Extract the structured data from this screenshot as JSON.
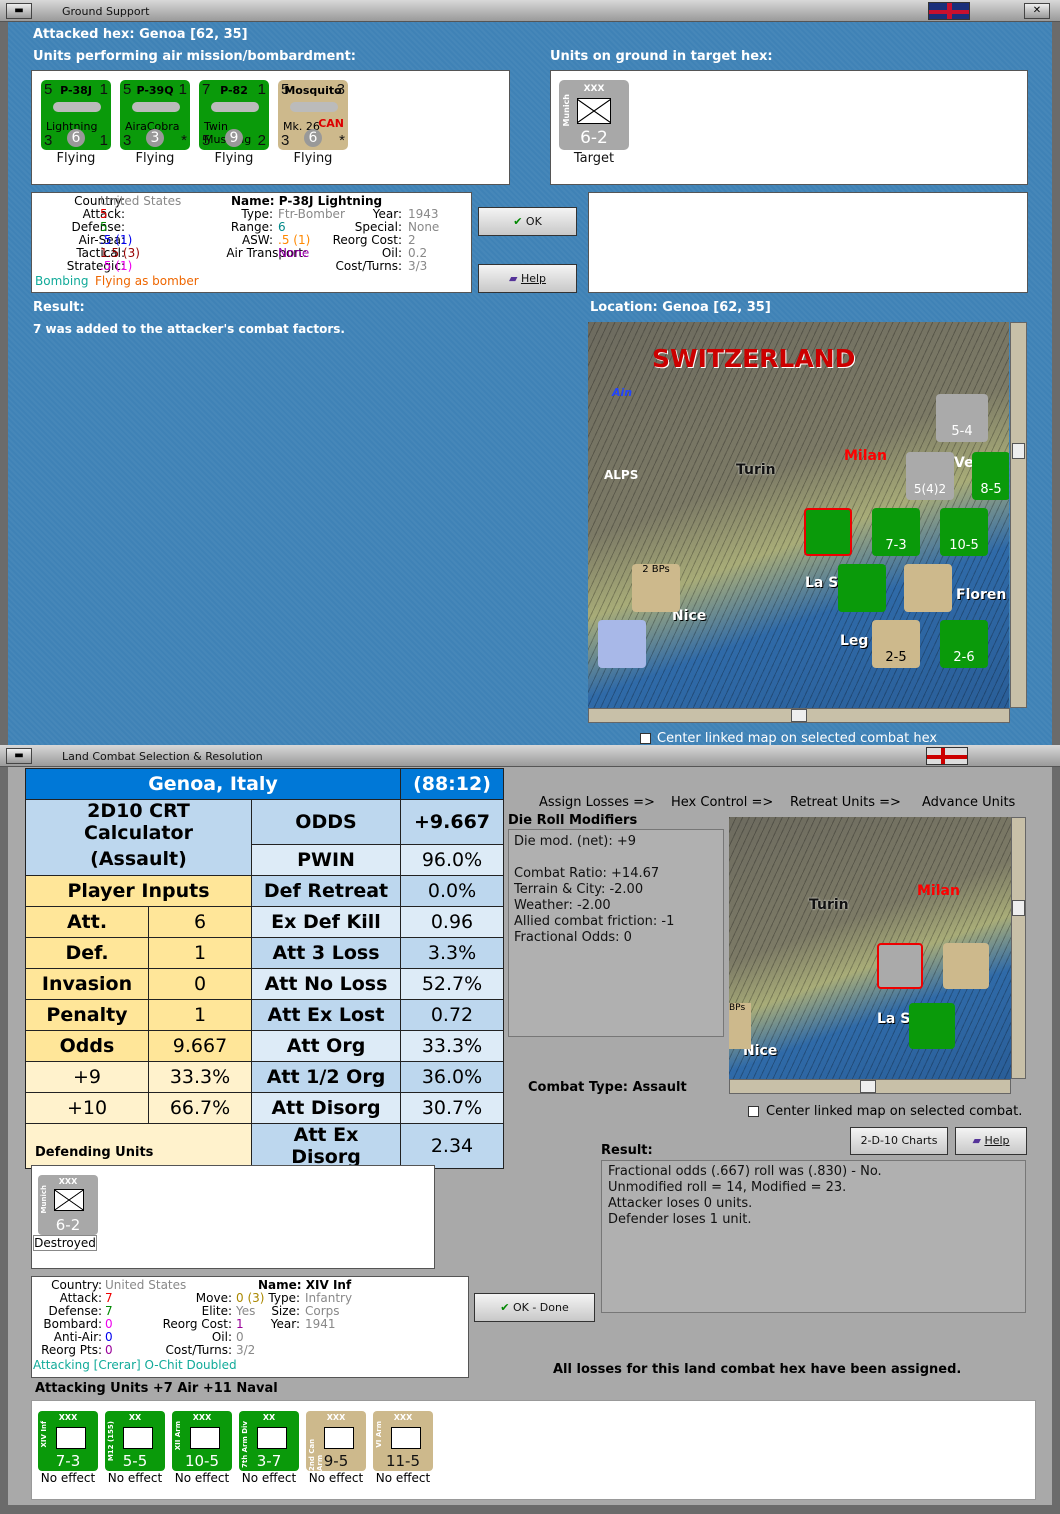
{
  "top_window": {
    "title": "Ground Support",
    "attacked_hex": "Attacked hex: Genoa  [62, 35]",
    "air_units_label": "Units performing air mission/bombardment:",
    "ground_units_label": "Units on ground in target hex:",
    "air_units": [
      {
        "name": "P-38J",
        "sub": "Lightning",
        "tl": "5",
        "tr": "1",
        "bl": "3",
        "bc": "6",
        "br": "1",
        "status": "Flying",
        "color": "green"
      },
      {
        "name": "P-39Q",
        "sub": "AiraCobra",
        "tl": "5",
        "tr": "1",
        "bl": "3",
        "bc": "3",
        "br": "*",
        "status": "Flying",
        "color": "green"
      },
      {
        "name": "P-82",
        "sub": "Twin Mustang",
        "tl": "7",
        "tr": "1",
        "bl": "5",
        "bc": "9",
        "br": "2",
        "status": "Flying",
        "color": "green"
      },
      {
        "name": "Mosquito",
        "sub": "Mk. 26",
        "extra": "CAN",
        "tl": "5",
        "tr": "3",
        "bl": "3",
        "bc": "6",
        "br": "*",
        "status": "Flying",
        "color": "tan"
      }
    ],
    "ground_units": [
      {
        "name": "Munich",
        "size": "XXX",
        "value": "6-2",
        "status": "Target"
      }
    ],
    "unit_info": {
      "country_l": "Country:",
      "country": "United States",
      "attack_l": "Attack:",
      "attack": "5",
      "defense_l": "Defense:",
      "defense": "5",
      "airsea_l": "Air-Sea:",
      "airsea": ".5 (1)",
      "tactical_l": "Tactical:",
      "tactical": "1.5 (3)",
      "strategic_l": "Strategic:",
      "strategic": ".5 (1)",
      "mission_a": "Bombing",
      "mission_b": "Flying as bomber",
      "name": "Name: P-38J Lightning",
      "type_l": "Type:",
      "type": "Ftr-Bomber",
      "range_l": "Range:",
      "range": "6",
      "asw_l": "ASW:",
      "asw": ".5 (1)",
      "airtrans_l": "Air Transport:",
      "airtrans": "None",
      "year_l": "Year:",
      "year": "1943",
      "special_l": "Special:",
      "special": "None",
      "reorg_l": "Reorg Cost:",
      "reorg": "2",
      "oil_l": "Oil:",
      "oil": "0.2",
      "cost_l": "Cost/Turns:",
      "cost": "3/3"
    },
    "ok_label": "OK",
    "help_label": "Help",
    "result_label": "Result:",
    "result_text": "7 was added to the attacker's combat factors.",
    "location": "Location:  Genoa  [62, 35]",
    "map_labels": {
      "switzerland": "SWITZERLAND",
      "alps": "ALPS",
      "turin": "Turin",
      "milan": "Milan",
      "nice": "Nice",
      "la_s": "La S",
      "leg": "Leg",
      "floren": "Floren",
      "ain": "Ain",
      "bps": "2 BPs",
      "ve": "Ve",
      "c54": "5-4",
      "c85": "8-5",
      "c73": "7-3",
      "c105": "10-5",
      "c25": "2-5",
      "c26": "2-6",
      "c542": "5(4)2"
    },
    "center_checkbox": "Center linked map on selected combat hex"
  },
  "bottom_window": {
    "title": "Land Combat Selection & Resolution",
    "crt": {
      "location": "Genoa, Italy",
      "ratio": "(88:12)",
      "calc_title": "2D10 CRT Calculator",
      "calc_mode": "(Assault)",
      "player_inputs": "Player Inputs",
      "inputs": [
        {
          "label": "Att.",
          "value": "6"
        },
        {
          "label": "Def.",
          "value": "1"
        },
        {
          "label": "Invasion",
          "value": "0"
        },
        {
          "label": "Penalty",
          "value": "1"
        },
        {
          "label": "Odds",
          "value": "9.667"
        }
      ],
      "odds_rows": [
        {
          "label": "+9",
          "value": "33.3%"
        },
        {
          "label": "+10",
          "value": "66.7%"
        }
      ],
      "results": [
        {
          "label": "ODDS",
          "value": "+9.667"
        },
        {
          "label": "PWIN",
          "value": "96.0%"
        },
        {
          "label": "Def Retreat",
          "value": "0.0%"
        },
        {
          "label": "Ex Def Kill",
          "value": "0.96"
        },
        {
          "label": "Att 3 Loss",
          "value": "3.3%"
        },
        {
          "label": "Att No Loss",
          "value": "52.7%"
        },
        {
          "label": "Att Ex Lost",
          "value": "0.72"
        },
        {
          "label": "Att Org",
          "value": "33.3%"
        },
        {
          "label": "Att 1/2 Org",
          "value": "36.0%"
        },
        {
          "label": "Att Disorg",
          "value": "30.7%"
        },
        {
          "label": "Att Ex Disorg",
          "value": "2.34"
        }
      ]
    },
    "steps": [
      "Assign Losses =>",
      "Hex Control =>",
      "Retreat Units =>",
      "Advance Units"
    ],
    "modifiers_label": "Die Roll Modifiers",
    "modifiers": [
      "Die mod. (net): +9",
      "",
      "Combat Ratio: +14.67",
      "Terrain & City: -2.00",
      "Weather: -2.00",
      "Allied combat friction: -1",
      "Fractional Odds: 0"
    ],
    "combat_type": "Combat Type:  Assault",
    "center_checkbox": "Center linked map on selected combat.",
    "charts_label": "2-D-10 Charts",
    "help_label": "Help",
    "result_label": "Result:",
    "result_lines": [
      "Fractional odds (.667) roll was (.830)  - No.",
      "Unmodified roll = 14, Modified = 23.",
      "Attacker loses 0 units.",
      "Defender loses 1 unit."
    ],
    "defending_label": "Defending Units",
    "defenders": [
      {
        "name": "Munich",
        "size": "XXX",
        "value": "6-2",
        "status": "Destroyed"
      }
    ],
    "unit_info": {
      "country_l": "Country:",
      "country": "United States",
      "attack_l": "Attack:",
      "attack": "7",
      "defense_l": "Defense:",
      "defense": "7",
      "bombard_l": "Bombard:",
      "bombard": "0",
      "antiair_l": "Anti-Air:",
      "antiair": "0",
      "reorgpts_l": "Reorg Pts:",
      "reorgpts": "0",
      "status": "Attacking [Crerar] O-Chit Doubled",
      "name": "Name: XIV Inf",
      "move_l": "Move:",
      "move": "0 (3)",
      "elite_l": "Elite:",
      "elite": "Yes",
      "reorg_l": "Reorg Cost:",
      "reorg": "1",
      "oil_l": "Oil:",
      "oil": "0",
      "cost_l": "Cost/Turns:",
      "cost": "3/2",
      "type_l": "Type:",
      "type": "Infantry",
      "size_l": "Size:",
      "size": "Corps",
      "year_l": "Year:",
      "year": "1941"
    },
    "ok_done_label": "OK - Done",
    "all_losses": "All losses for this land combat hex have been assigned.",
    "attacking_label": "Attacking Units +7 Air +11 Naval",
    "attackers": [
      {
        "name": "XIV Inf",
        "size": "XXX",
        "value": "7-3",
        "status": "No effect",
        "color": "#0a9a0a"
      },
      {
        "name": "M12 (155)",
        "size": "XX",
        "value": "5-5",
        "status": "No effect",
        "color": "#0a9a0a"
      },
      {
        "name": "XII Arm",
        "size": "XXX",
        "value": "10-5",
        "status": "No effect",
        "color": "#0a9a0a"
      },
      {
        "name": "7th Arm Div",
        "size": "XX",
        "value": "3-7",
        "status": "No effect",
        "color": "#0a9a0a"
      },
      {
        "name": "2nd Can Arm",
        "size": "XXX",
        "value": "9-5",
        "status": "No effect",
        "color": "#cdb98c"
      },
      {
        "name": "VI Arm",
        "size": "XXX",
        "value": "11-5",
        "status": "No effect",
        "color": "#cdb98c"
      }
    ],
    "map_labels": {
      "turin": "Turin",
      "milan": "Milan",
      "nice": "Nice",
      "la_s": "La S",
      "bps": "BPs"
    }
  },
  "colors": {
    "top_bg": "#3f82b6",
    "crt_header": "#0078d7",
    "crt_light": "#bdd7ee",
    "crt_yellow": "#ffe699"
  }
}
